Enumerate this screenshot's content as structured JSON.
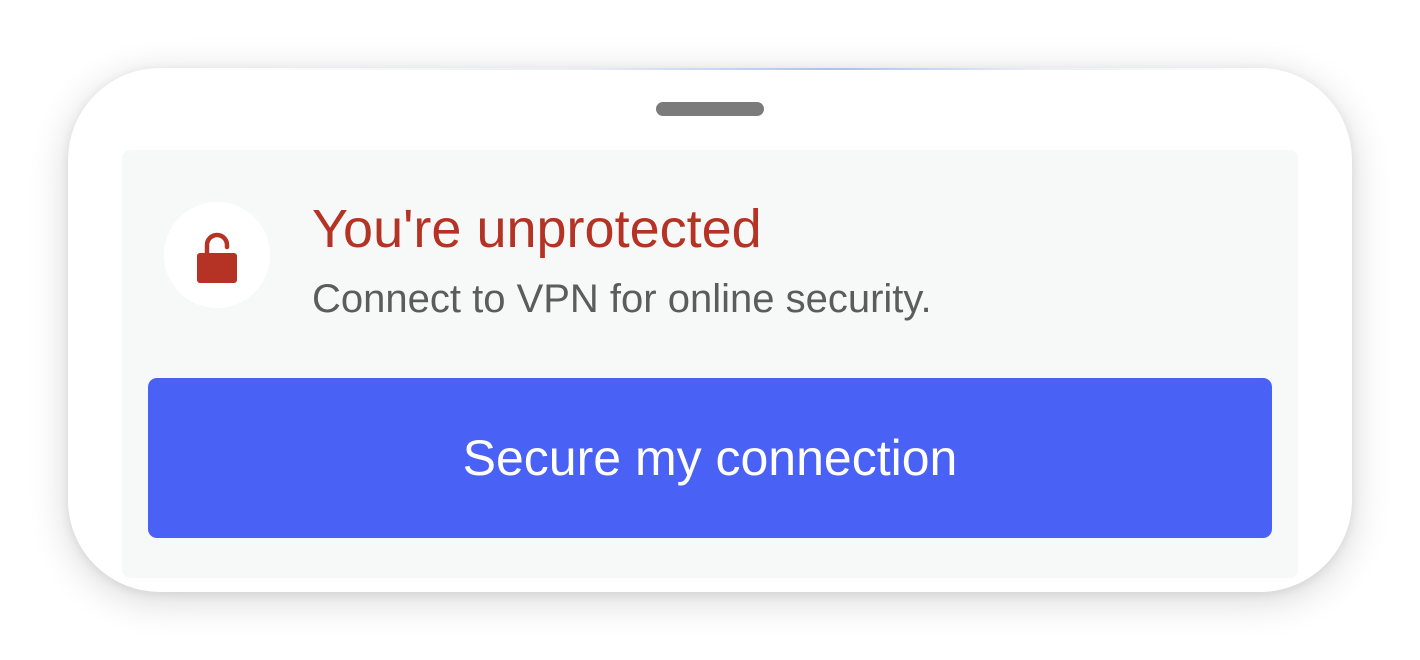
{
  "status": {
    "title": "You're unprotected",
    "message": "Connect to VPN for online security.",
    "icon": "unlocked-padlock-icon",
    "title_color": "#b43325"
  },
  "actions": {
    "primary_label": "Secure my connection",
    "primary_color": "#4a61f5"
  }
}
